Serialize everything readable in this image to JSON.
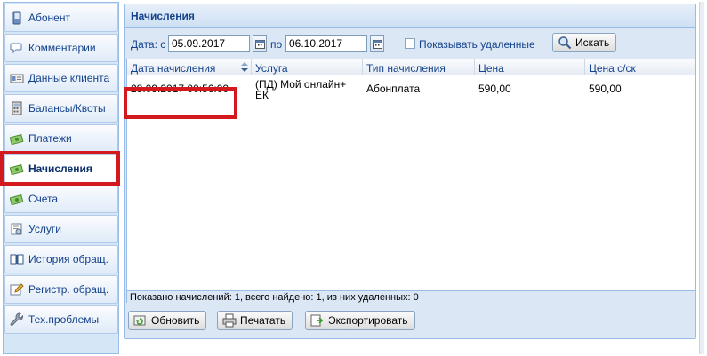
{
  "sidebar": {
    "items": [
      {
        "label": "Абонент",
        "icon": "phone-icon"
      },
      {
        "label": "Комментарии",
        "icon": "comments-icon"
      },
      {
        "label": "Данные клиента",
        "icon": "id-card-icon"
      },
      {
        "label": "Балансы/Квоты",
        "icon": "calculator-icon"
      },
      {
        "label": "Платежи",
        "icon": "money-icon"
      },
      {
        "label": "Начисления",
        "icon": "money-icon"
      },
      {
        "label": "Счета",
        "icon": "money-icon"
      },
      {
        "label": "Услуги",
        "icon": "services-icon"
      },
      {
        "label": "История обращ.",
        "icon": "book-icon"
      },
      {
        "label": "Регистр. обращ.",
        "icon": "edit-icon"
      },
      {
        "label": "Тех.проблемы",
        "icon": "wrench-icon"
      }
    ],
    "active_label": "Начисления"
  },
  "panel": {
    "title": "Начисления",
    "filter": {
      "date_from_label": "Дата: с",
      "date_from": "05.09.2017",
      "date_to_label": "по",
      "date_to": "06.10.2017",
      "show_deleted_label": "Показывать удаленные",
      "show_deleted_checked": false,
      "search_label": "Искать"
    },
    "grid": {
      "columns": [
        "Дата начисления",
        "Услуга",
        "Тип начисления",
        "Цена",
        "Цена с/ск"
      ],
      "rows": [
        {
          "date": "28.09.2017 00:56:00",
          "service": "(ПД) Мой онлайн+ ЕК",
          "type": "Абонплата",
          "price": "590,00",
          "price_discount": "590,00"
        }
      ],
      "status": "Показано начислений: 1, всего найдено: 1, из них удаленных: 0"
    },
    "buttons": {
      "refresh": "Обновить",
      "print": "Печатать",
      "export": "Экспортировать"
    }
  },
  "colors": {
    "accent_red": "#d3191d",
    "header_text": "#15428b",
    "panel_bg": "#dbe7f5"
  }
}
